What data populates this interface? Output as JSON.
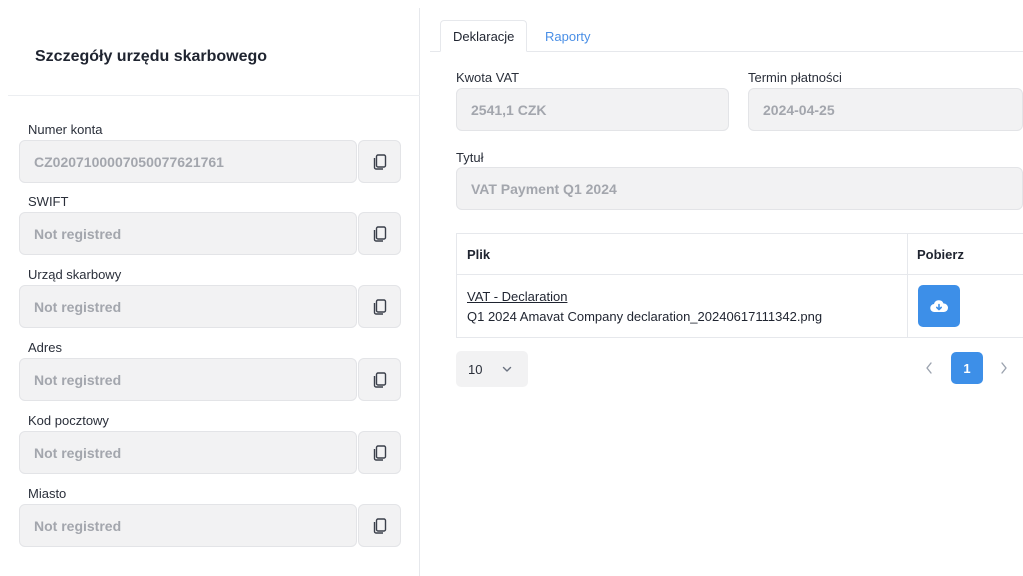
{
  "left": {
    "title": "Szczegóły urzędu skarbowego",
    "fields": [
      {
        "label": "Numer konta",
        "value": "CZ0207100007050077621761"
      },
      {
        "label": "SWIFT",
        "value": "Not registred"
      },
      {
        "label": "Urząd skarbowy",
        "value": "Not registred"
      },
      {
        "label": "Adres",
        "value": "Not registred"
      },
      {
        "label": "Kod pocztowy",
        "value": "Not registred"
      },
      {
        "label": "Miasto",
        "value": "Not registred"
      }
    ]
  },
  "tabs": [
    {
      "label": "Deklaracje",
      "active": true
    },
    {
      "label": "Raporty",
      "active": false
    }
  ],
  "declaration": {
    "vat_label": "Kwota VAT",
    "vat_value": "2541,1 CZK",
    "due_label": "Termin płatności",
    "due_value": "2024-04-25",
    "title_label": "Tytuł",
    "title_value": "VAT Payment Q1 2024"
  },
  "files_table": {
    "headers": [
      "Plik",
      "Pobierz"
    ],
    "rows": [
      {
        "link": "VAT - Declaration",
        "filename": "Q1 2024 Amavat Company declaration_20240617111342.png"
      }
    ]
  },
  "pagination": {
    "page_size": "10",
    "current_page": "1"
  },
  "colors": {
    "accent": "#3d8fe8",
    "tab_inactive": "#4a8fe6",
    "input_bg": "#f2f2f3"
  },
  "icons": {
    "copy": "copy-icon",
    "download": "cloud-download-icon",
    "chevron_down": "chevron-down-icon",
    "chevron_left": "chevron-left-icon",
    "chevron_right": "chevron-right-icon"
  }
}
